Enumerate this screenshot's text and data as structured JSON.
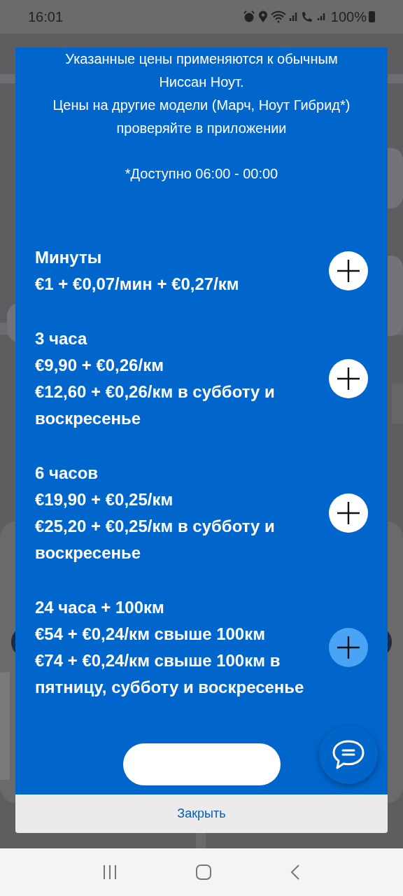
{
  "status_bar": {
    "time": "16:01",
    "battery": "100%"
  },
  "dialog": {
    "intro": [
      "Указанные цены применяются к обычным Ниссан Ноут.",
      "Цены на другие модели (Марч, Ноут Гибрид*) проверяйте в приложении"
    ],
    "note": "*Доступно 06:00 - 00:00",
    "plans": [
      {
        "title": "Минуты",
        "prices": [
          "€1 + €0,07/мин + €0,27/км"
        ],
        "pressed": false
      },
      {
        "title": "3 часа",
        "prices": [
          "€9,90 + €0,26/км",
          "€12,60 + €0,26/км в субботу и воскресенье"
        ],
        "pressed": false
      },
      {
        "title": "6 часов",
        "prices": [
          "€19,90 + €0,25/км",
          "€25,20 + €0,25/км в субботу и воскресенье"
        ],
        "pressed": false
      },
      {
        "title": "24 часа + 100км",
        "prices": [
          "€54 + €0,24/км свыше 100км",
          "€74 + €0,24/км свыше 100км в пятницу, субботу и воскресенье"
        ],
        "pressed": true
      }
    ],
    "close_button": "Закрыть"
  }
}
